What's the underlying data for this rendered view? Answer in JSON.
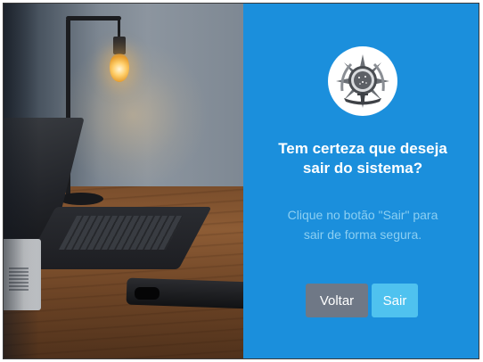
{
  "dialog": {
    "title": "Tem certeza que deseja sair do sistema?",
    "message": "Clique no botão \"Sair\" para sair de forma segura.",
    "back_label": "Voltar",
    "exit_label": "Sair"
  },
  "icons": {
    "emblem": "coat-of-arms-of-brazil",
    "hero": "desk-laptop-lamp-photo"
  },
  "colors": {
    "panel_bg": "#1b8fdc",
    "title": "#ffffff",
    "message": "#8ccff2",
    "back_button": "#6f7886",
    "exit_button": "#4fc2ef"
  }
}
